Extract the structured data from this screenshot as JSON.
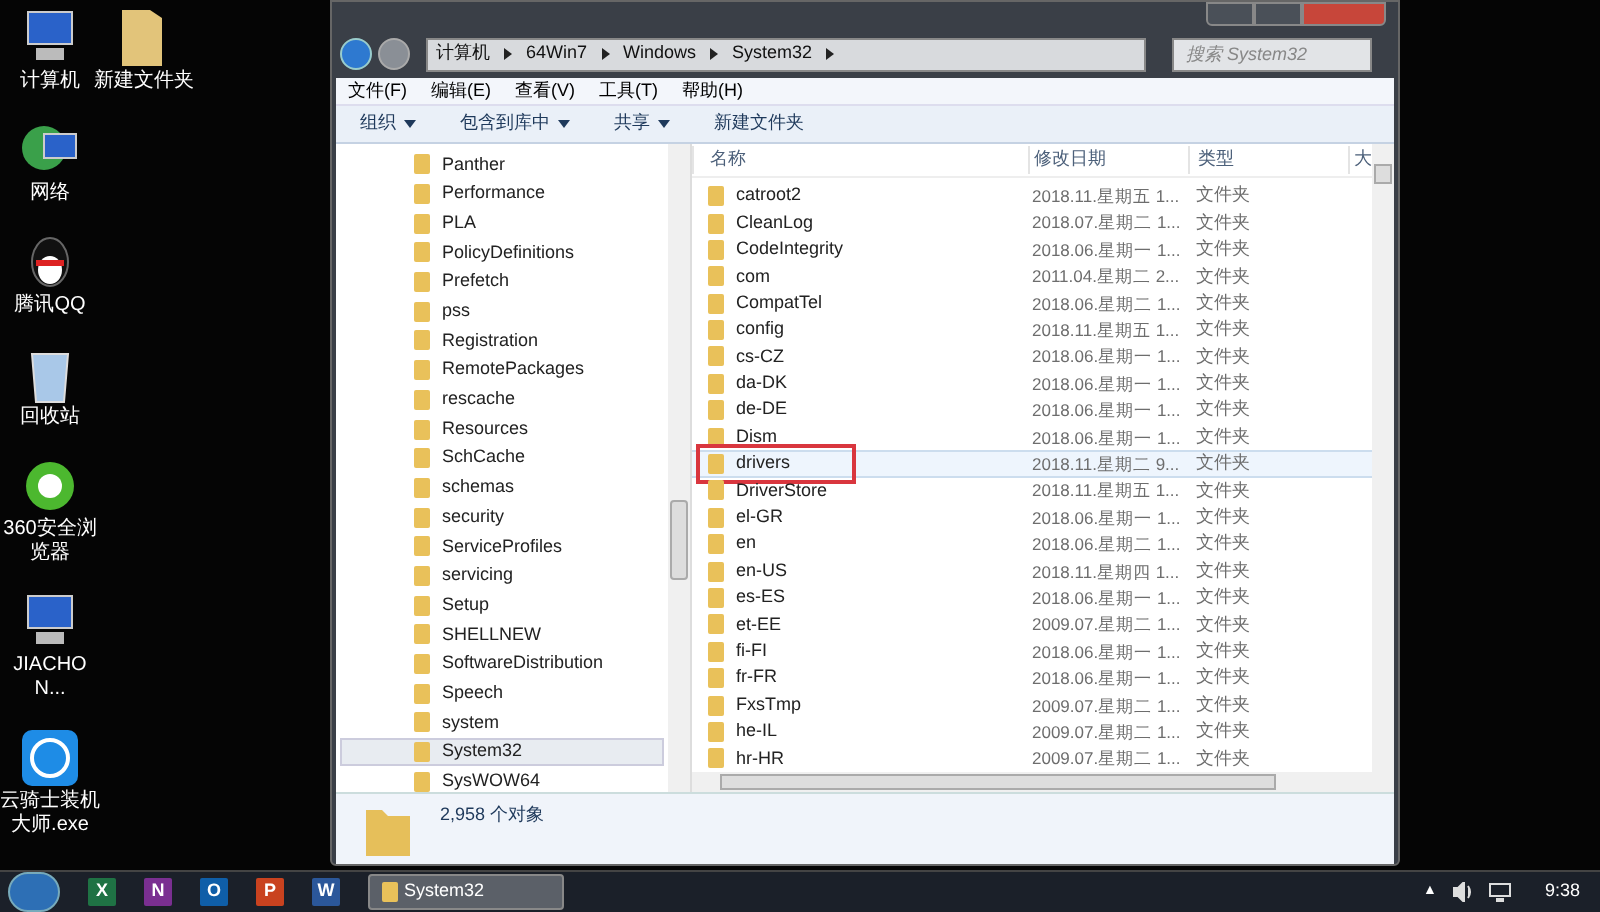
{
  "desktop_icons": [
    {
      "label": "计算机",
      "kind": "computer"
    },
    {
      "label": "网络",
      "kind": "network"
    },
    {
      "label": "腾讯QQ",
      "kind": "penguin"
    },
    {
      "label": "回收站",
      "kind": "bin"
    },
    {
      "label": "360安全浏览器",
      "kind": "browser"
    },
    {
      "label": "JIACHON...",
      "kind": "computer"
    },
    {
      "label": "云骑士装机大师.exe",
      "kind": "app"
    }
  ],
  "desktop_folder": {
    "label": "新建文件夹"
  },
  "address_bar": {
    "crumbs": [
      "计算机",
      "64Win7",
      "Windows",
      "System32"
    ]
  },
  "search": {
    "placeholder": "搜索 System32"
  },
  "menu": [
    "文件(F)",
    "编辑(E)",
    "查看(V)",
    "工具(T)",
    "帮助(H)"
  ],
  "toolbar": [
    {
      "label": "组织",
      "dropdown": true
    },
    {
      "label": "包含到库中",
      "dropdown": true
    },
    {
      "label": "共享",
      "dropdown": true
    },
    {
      "label": "新建文件夹",
      "dropdown": false
    }
  ],
  "tree": [
    {
      "label": "Panther",
      "selected": false
    },
    {
      "label": "Performance",
      "selected": false
    },
    {
      "label": "PLA",
      "selected": false
    },
    {
      "label": "PolicyDefinitions",
      "selected": false
    },
    {
      "label": "Prefetch",
      "selected": false
    },
    {
      "label": "pss",
      "selected": false
    },
    {
      "label": "Registration",
      "selected": false
    },
    {
      "label": "RemotePackages",
      "selected": false
    },
    {
      "label": "rescache",
      "selected": false
    },
    {
      "label": "Resources",
      "selected": false
    },
    {
      "label": "SchCache",
      "selected": false
    },
    {
      "label": "schemas",
      "selected": false
    },
    {
      "label": "security",
      "selected": false
    },
    {
      "label": "ServiceProfiles",
      "selected": false
    },
    {
      "label": "servicing",
      "selected": false
    },
    {
      "label": "Setup",
      "selected": false
    },
    {
      "label": "SHELLNEW",
      "selected": false
    },
    {
      "label": "SoftwareDistribution",
      "selected": false
    },
    {
      "label": "Speech",
      "selected": false
    },
    {
      "label": "system",
      "selected": false
    },
    {
      "label": "System32",
      "selected": true
    },
    {
      "label": "SysWOW64",
      "selected": false
    }
  ],
  "table": {
    "columns": [
      "名称",
      "修改日期",
      "类型",
      "大"
    ],
    "rows": [
      {
        "name": "catroot2",
        "date": "2018.11.星期五 1...",
        "type": "文件夹",
        "hovered": false,
        "marked": false
      },
      {
        "name": "CleanLog",
        "date": "2018.07.星期二 1...",
        "type": "文件夹",
        "hovered": false,
        "marked": false
      },
      {
        "name": "CodeIntegrity",
        "date": "2018.06.星期一 1...",
        "type": "文件夹",
        "hovered": false,
        "marked": false
      },
      {
        "name": "com",
        "date": "2011.04.星期二 2...",
        "type": "文件夹",
        "hovered": false,
        "marked": false
      },
      {
        "name": "CompatTel",
        "date": "2018.06.星期二 1...",
        "type": "文件夹",
        "hovered": false,
        "marked": false
      },
      {
        "name": "config",
        "date": "2018.11.星期五 1...",
        "type": "文件夹",
        "hovered": false,
        "marked": false
      },
      {
        "name": "cs-CZ",
        "date": "2018.06.星期一 1...",
        "type": "文件夹",
        "hovered": false,
        "marked": false
      },
      {
        "name": "da-DK",
        "date": "2018.06.星期一 1...",
        "type": "文件夹",
        "hovered": false,
        "marked": false
      },
      {
        "name": "de-DE",
        "date": "2018.06.星期一 1...",
        "type": "文件夹",
        "hovered": false,
        "marked": false
      },
      {
        "name": "Dism",
        "date": "2018.06.星期一 1...",
        "type": "文件夹",
        "hovered": false,
        "marked": false
      },
      {
        "name": "drivers",
        "date": "2018.11.星期二 9...",
        "type": "文件夹",
        "hovered": true,
        "marked": true
      },
      {
        "name": "DriverStore",
        "date": "2018.11.星期五 1...",
        "type": "文件夹",
        "hovered": false,
        "marked": false
      },
      {
        "name": "el-GR",
        "date": "2018.06.星期一 1...",
        "type": "文件夹",
        "hovered": false,
        "marked": false
      },
      {
        "name": "en",
        "date": "2018.06.星期二 1...",
        "type": "文件夹",
        "hovered": false,
        "marked": false
      },
      {
        "name": "en-US",
        "date": "2018.11.星期四 1...",
        "type": "文件夹",
        "hovered": false,
        "marked": false
      },
      {
        "name": "es-ES",
        "date": "2018.06.星期一 1...",
        "type": "文件夹",
        "hovered": false,
        "marked": false
      },
      {
        "name": "et-EE",
        "date": "2009.07.星期二 1...",
        "type": "文件夹",
        "hovered": false,
        "marked": false
      },
      {
        "name": "fi-FI",
        "date": "2018.06.星期一 1...",
        "type": "文件夹",
        "hovered": false,
        "marked": false
      },
      {
        "name": "fr-FR",
        "date": "2018.06.星期一 1...",
        "type": "文件夹",
        "hovered": false,
        "marked": false
      },
      {
        "name": "FxsTmp",
        "date": "2009.07.星期二 1...",
        "type": "文件夹",
        "hovered": false,
        "marked": false
      },
      {
        "name": "he-IL",
        "date": "2009.07.星期二 1...",
        "type": "文件夹",
        "hovered": false,
        "marked": false
      },
      {
        "name": "hr-HR",
        "date": "2009.07.星期二 1...",
        "type": "文件夹",
        "hovered": false,
        "marked": false
      }
    ]
  },
  "status_bar": {
    "text": "2,958 个对象"
  },
  "taskbar": {
    "apps": [
      {
        "label": "X",
        "color": "#1f7244"
      },
      {
        "label": "N",
        "color": "#7a2f91"
      },
      {
        "label": "O",
        "color": "#0f5ea8"
      },
      {
        "label": "P",
        "color": "#c9421f"
      },
      {
        "label": "W",
        "color": "#2b579a"
      }
    ],
    "task": "System32",
    "tray_arrow": "▲",
    "clock": "9:38"
  }
}
